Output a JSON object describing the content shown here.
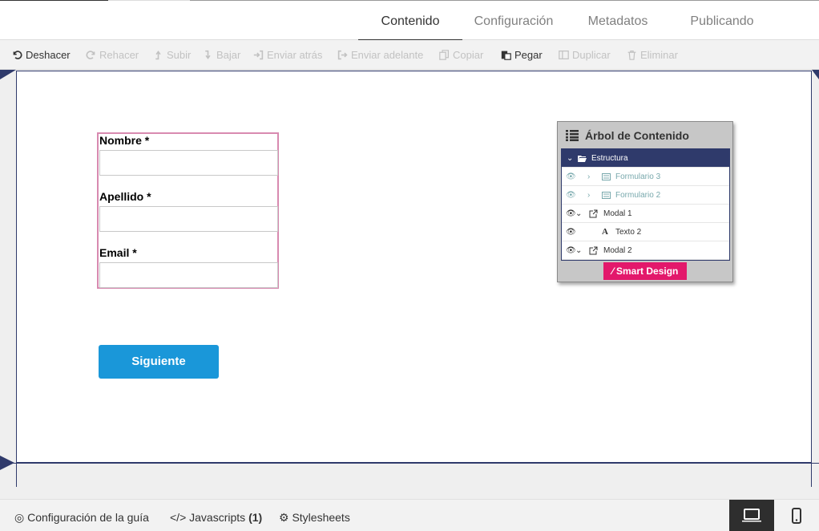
{
  "tabs": [
    {
      "label": "Contenido",
      "active": true
    },
    {
      "label": "Configuración",
      "active": false
    },
    {
      "label": "Metadatos",
      "active": false
    },
    {
      "label": "Publicando",
      "active": false
    }
  ],
  "toolbar": {
    "undo": "Deshacer",
    "redo": "Rehacer",
    "up": "Subir",
    "down": "Bajar",
    "send_back": "Enviar atrás",
    "send_forward": "Enviar adelante",
    "copy": "Copiar",
    "paste": "Pegar",
    "duplicate": "Duplicar",
    "delete": "Eliminar"
  },
  "form": {
    "first_name_label": "Nombre *",
    "last_name_label": "Apellido *",
    "email_label": "Email *",
    "next_button": "Siguiente"
  },
  "content_tree": {
    "title": "Árbol de Contenido",
    "root": "Estructura",
    "items": [
      {
        "label": "Formulario 3",
        "hidden": true
      },
      {
        "label": "Formulario 2",
        "hidden": true
      },
      {
        "label": "Modal 1",
        "hidden": false
      },
      {
        "label": "Texto 2",
        "hidden": false
      },
      {
        "label": "Modal 2",
        "hidden": false
      }
    ],
    "smart_design": "Smart Design"
  },
  "bottom": {
    "guide_config": "Configuración de la guía",
    "javascripts": "Javascripts",
    "javascripts_count": "(1)",
    "stylesheets": "Stylesheets"
  },
  "colors": {
    "accent_blue": "#1a97d9",
    "navy": "#2f3a6b",
    "smart_pink": "#e3186b",
    "form_border": "#d88ab0"
  }
}
